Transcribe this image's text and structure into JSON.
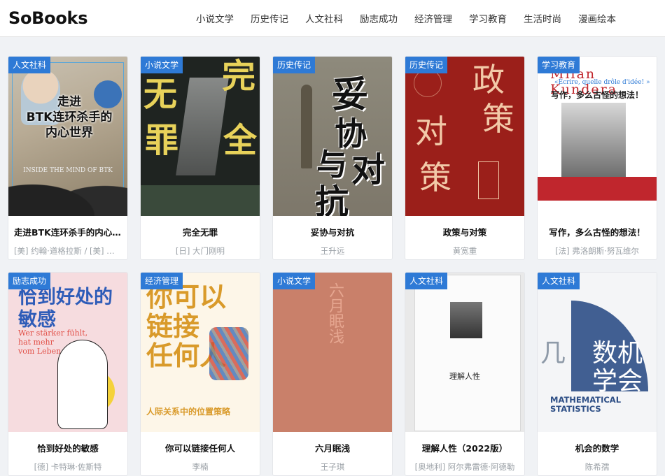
{
  "header": {
    "logo": "SoBooks",
    "nav": [
      "小说文学",
      "历史传记",
      "人文社科",
      "励志成功",
      "经济管理",
      "学习教育",
      "生活时尚",
      "漫画绘本"
    ]
  },
  "books": [
    {
      "tag": "人文社科",
      "title": "走进BTK连环杀手的内心世界",
      "author": "[美] 约翰·道格拉斯 / [美] 约翰·道格拉斯 / [美] 约翰·道格拉斯",
      "cover_text": "走进\nBTK连环杀手的\n内心世界",
      "cover_sub": "INSIDE THE MIND OF BTK"
    },
    {
      "tag": "小说文学",
      "title": "完全无罪",
      "author": "[日] 大门刚明",
      "cover_text": "完全无罪"
    },
    {
      "tag": "历史传记",
      "title": "妥协与对抗",
      "author": "王升远",
      "cover_text": "妥协与对抗"
    },
    {
      "tag": "历史传记",
      "title": "政策与对策",
      "author": "黄宽重",
      "cover_text": "政策与对策"
    },
    {
      "tag": "学习教育",
      "title": "写作，多么古怪的想法！",
      "author": "[法] 弗洛朗斯·努瓦维尔",
      "cover_text": "写作，多么古怪的想法！",
      "cover_name": "Milan Kundera",
      "cover_quote": "«Écrire, quelle drôle d'idée! »"
    },
    {
      "tag": "励志成功",
      "title": "恰到好处的敏感",
      "author": "[德] 卡特琳·佐斯特",
      "cover_text": "恰到好处的\n敏感",
      "cover_sub": "Wer stärker fühlt,\nhat mehr\nvom Leben"
    },
    {
      "tag": "经济管理",
      "title": "你可以链接任何人",
      "author": "李楠",
      "cover_text": "你可以\n链接\n任何人",
      "cover_sub": "人际关系中的位置策略"
    },
    {
      "tag": "小说文学",
      "title": "六月眠浅",
      "author": "王子琪",
      "cover_text": "六月眠浅"
    },
    {
      "tag": "人文社科",
      "title": "理解人性（2022版）",
      "author": "[奥地利] 阿尔弗雷德·阿德勒",
      "cover_text": "理解人性"
    },
    {
      "tag": "人文社科",
      "title": "机会的数学",
      "author": "陈希孺",
      "cover_text": "机会的数学",
      "cover_sub": "MATHEMATICAL\nSTATISTICS"
    }
  ]
}
